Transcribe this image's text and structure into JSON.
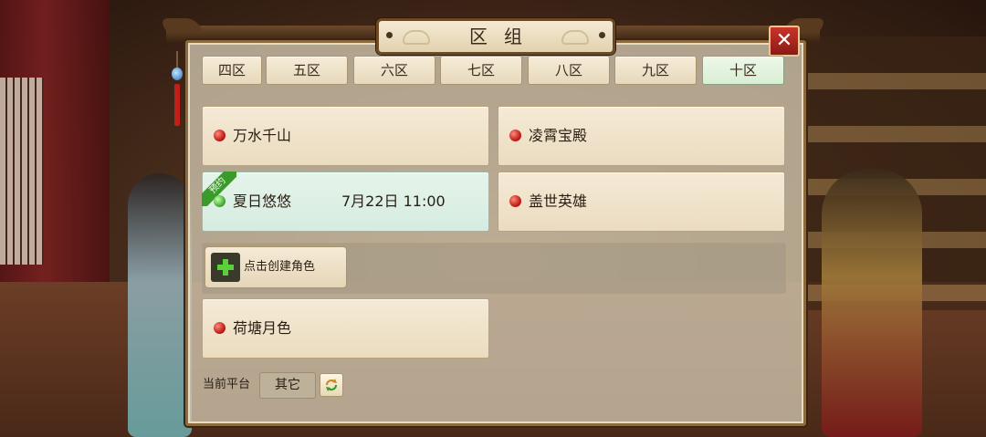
{
  "dialog": {
    "title": "区组",
    "close_glyph": "✕"
  },
  "tabs": [
    {
      "label": "四区",
      "active": false
    },
    {
      "label": "五区",
      "active": false
    },
    {
      "label": "六区",
      "active": false
    },
    {
      "label": "七区",
      "active": false
    },
    {
      "label": "八区",
      "active": false
    },
    {
      "label": "九区",
      "active": false
    },
    {
      "label": "十区",
      "active": true
    }
  ],
  "servers": [
    {
      "name": "万水千山",
      "status": "red"
    },
    {
      "name": "凌霄宝殿",
      "status": "red"
    },
    {
      "name": "夏日悠悠",
      "status": "green",
      "time": "7月22日 11:00",
      "badge": "预约"
    },
    {
      "name": "盖世英雄",
      "status": "red"
    },
    {
      "name": "荷塘月色",
      "status": "red"
    }
  ],
  "create_role": {
    "label": "点击创建角色"
  },
  "platform": {
    "label": "当前平台",
    "value": "其它"
  },
  "colors": {
    "accent_green": "#3a9a2a",
    "status_red": "#c0201a",
    "close_red": "#c8342a"
  },
  "icons": [
    "plus-icon",
    "refresh-icon",
    "close-icon",
    "status-dot-icon",
    "charm-icon"
  ]
}
